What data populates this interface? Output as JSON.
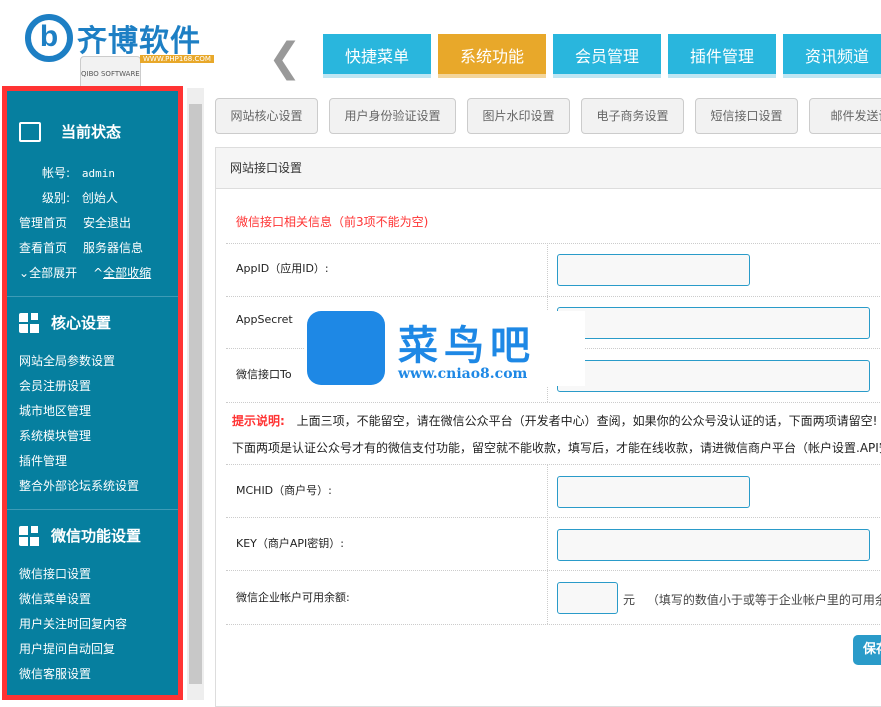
{
  "logo": {
    "name": "齐博软件",
    "subtitle": "QIBO SOFTWARE",
    "url": "WWW.PHP168.COM"
  },
  "topnav": [
    {
      "label": "快捷菜单"
    },
    {
      "label": "系统功能",
      "active": true
    },
    {
      "label": "会员管理"
    },
    {
      "label": "插件管理"
    },
    {
      "label": "资讯频道"
    }
  ],
  "sidebar": {
    "status": {
      "title": "当前状态",
      "account_label": "帐号:",
      "account": "admin",
      "level_label": "级别:",
      "level": "创始人",
      "links": [
        "管理首页",
        "安全退出",
        "查看首页",
        "服务器信息"
      ],
      "expand": "全部展开",
      "collapse": "全部收缩"
    },
    "core": {
      "title": "核心设置",
      "items": [
        "网站全局参数设置",
        "会员注册设置",
        "城市地区管理",
        "系统模块管理",
        "插件管理",
        "整合外部论坛系统设置"
      ]
    },
    "wechat": {
      "title": "微信功能设置",
      "items": [
        "微信接口设置",
        "微信菜单设置",
        "用户关注时回复内容",
        "用户提问自动回复",
        "微信客服设置"
      ]
    }
  },
  "subtabs": [
    "网站核心设置",
    "用户身份验证设置",
    "图片水印设置",
    "电子商务设置",
    "短信接口设置",
    "邮件发送设"
  ],
  "panel": {
    "title": "网站接口设置",
    "section_title": "微信接口相关信息（前3项不能为空)",
    "fields": {
      "appid": "AppID（应用ID）:",
      "appsecret": "AppSecret",
      "token": "微信接口To",
      "mchid": "MCHID（商户号）:",
      "key": "KEY（商户API密钥）:",
      "balance": "微信企业帐户可用余额:"
    },
    "tip_label": "提示说明:",
    "tip1": "上面三项，不能留空，请在微信公众平台（开发者中心）查阅，如果你的公众号没认证的话，下面两项请留空!",
    "tip2": "下面两项是认证公众号才有的微信支付功能，留空就不能收款，填写后，才能在线收款，请进微信商户平台（帐户设置.API安",
    "balance_unit": "元",
    "balance_hint": "（填写的数值小于或等于企业帐户里的可用余额)",
    "save": "保存"
  },
  "watermark": {
    "text": "菜鸟吧",
    "url": "www.cniao8.com"
  }
}
